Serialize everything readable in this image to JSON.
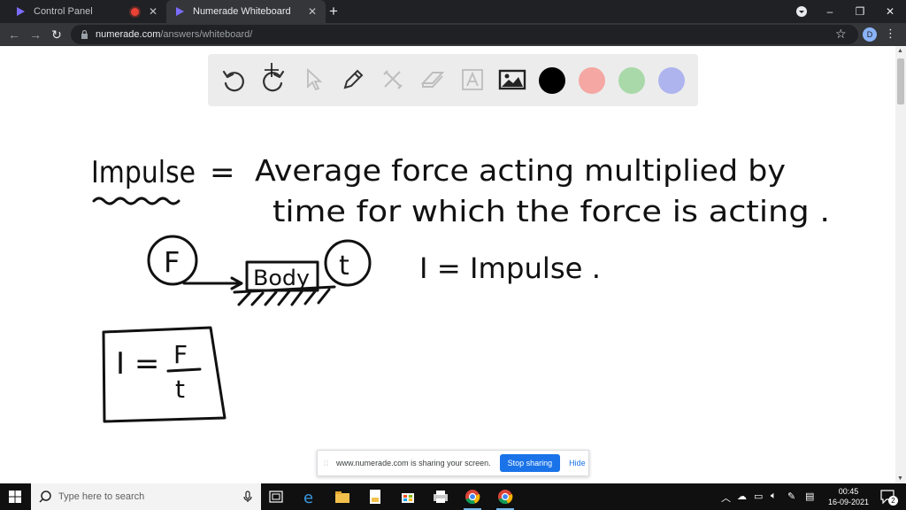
{
  "browser": {
    "tabs": [
      {
        "label": "Control Panel",
        "active": false,
        "recording": true
      },
      {
        "label": "Numerade Whiteboard",
        "active": true,
        "recording": false
      }
    ],
    "profile_initial": "D",
    "url_host": "numerade.com",
    "url_path": "/answers/whiteboard/"
  },
  "whiteboard": {
    "tools": [
      "undo-icon",
      "redo-icon",
      "select-icon",
      "pen-icon",
      "tools-icon",
      "eraser-icon",
      "text-icon",
      "image-icon"
    ],
    "colors": [
      "#000000",
      "#f4a7a3",
      "#a9d9a9",
      "#aeb4ee"
    ],
    "handwriting": {
      "line1_term": "Impulse",
      "equals": "=",
      "line1_def": "Average force acting multiplied by",
      "line2_def": "time for which the force is acting .",
      "force_circle": "F",
      "body_label": "Body",
      "time_circle": "t",
      "note": "I = Impulse .",
      "formula_lhs": "I =",
      "formula_num": "F",
      "formula_den": "t"
    }
  },
  "share_bar": {
    "message": "www.numerade.com is sharing your screen.",
    "stop_label": "Stop sharing",
    "hide_label": "Hide"
  },
  "taskbar": {
    "search_placeholder": "Type here to search",
    "time": "00:45",
    "date": "16-09-2021",
    "notifications": "2"
  }
}
